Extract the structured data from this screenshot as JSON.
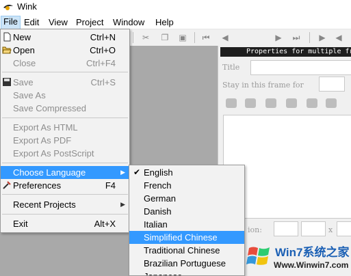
{
  "window": {
    "title": "Wink"
  },
  "menubar": [
    {
      "label": "File",
      "active": true
    },
    {
      "label": "Edit"
    },
    {
      "label": "View"
    },
    {
      "label": "Project"
    },
    {
      "label": "Window"
    },
    {
      "label": "Help"
    }
  ],
  "file_menu": {
    "new": {
      "label": "New",
      "shortcut": "Ctrl+N"
    },
    "open": {
      "label": "Open",
      "shortcut": "Ctrl+O"
    },
    "close": {
      "label": "Close",
      "shortcut": "Ctrl+F4"
    },
    "save": {
      "label": "Save",
      "shortcut": "Ctrl+S"
    },
    "save_as": {
      "label": "Save As"
    },
    "save_compressed": {
      "label": "Save Compressed"
    },
    "export_html": {
      "label": "Export As HTML"
    },
    "export_pdf": {
      "label": "Export As PDF"
    },
    "export_ps": {
      "label": "Export As PostScript"
    },
    "choose_language": {
      "label": "Choose Language"
    },
    "preferences": {
      "label": "Preferences",
      "shortcut": "F4"
    },
    "recent_projects": {
      "label": "Recent Projects"
    },
    "exit": {
      "label": "Exit",
      "shortcut": "Alt+X"
    }
  },
  "language_menu": {
    "selected": "English",
    "highlighted": "Simplified Chinese",
    "items": [
      "English",
      "French",
      "German",
      "Danish",
      "Italian",
      "Simplified Chinese",
      "Traditional Chinese",
      "Brazilian Portuguese",
      "Japanese"
    ]
  },
  "properties_panel": {
    "header": "Properties for multiple fr",
    "title_label": "Title",
    "stay_label": "Stay in this frame for",
    "position_label": "ion:",
    "x_label": "x"
  },
  "watermark": {
    "title": "Win7系统之家",
    "url": "Www.Winwin7.com"
  },
  "colors": {
    "highlight": "#3399ff",
    "menu_active": "#cce4f7",
    "workspace": "#a9a9a9"
  }
}
